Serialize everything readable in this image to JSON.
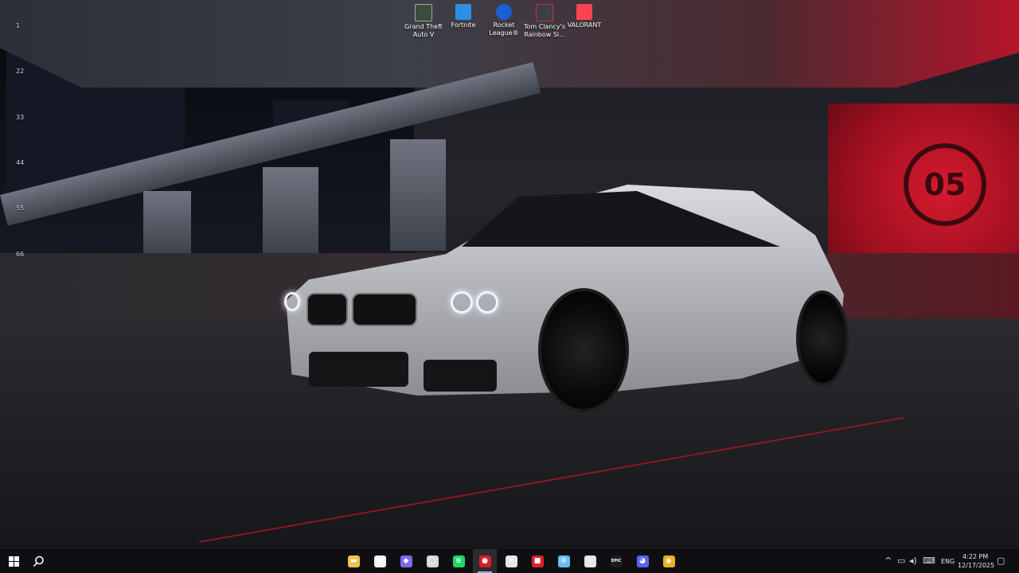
{
  "desktop": {
    "side_numbers": [
      "1",
      "22",
      "33",
      "44",
      "55",
      "66"
    ],
    "icons": [
      {
        "label": "Grand Theft Auto V",
        "icon": "gta-v-icon",
        "color": "#3c4b3a"
      },
      {
        "label": "Fortnite",
        "icon": "fortnite-icon",
        "color": "#2e8fe3"
      },
      {
        "label": "Rocket League®",
        "icon": "rocket-league-icon",
        "color": "#1a5fd6"
      },
      {
        "label": "Tom Clancy's Rainbow Si...",
        "icon": "rainbow-six-icon",
        "color": "#3a3f48"
      },
      {
        "label": "VALORANT",
        "icon": "valorant-icon",
        "color": "#fa4454"
      }
    ],
    "wallpaper_badge": "05"
  },
  "taskbar": {
    "start_icon": "windows-start-icon",
    "search_icon": "search-icon",
    "apps": [
      {
        "name": "file-explorer-icon",
        "glyph": "▬",
        "color": "#f0c34a"
      },
      {
        "name": "microsoft-store-icon",
        "glyph": "▣",
        "color": "#f2f2f2"
      },
      {
        "name": "game-controller-icon",
        "glyph": "◆",
        "color": "#7b6cf2"
      },
      {
        "name": "chat-app-icon",
        "glyph": "◯",
        "color": "#d9d9d9"
      },
      {
        "name": "spotify-icon",
        "glyph": "≋",
        "color": "#1ed760"
      },
      {
        "name": "red-app-icon",
        "glyph": "●",
        "color": "#d61f2b"
      },
      {
        "name": "capcut-icon",
        "glyph": "✕",
        "color": "#e6e6e6"
      },
      {
        "name": "rockstar-launcher-icon",
        "glyph": "■",
        "color": "#e0202e"
      },
      {
        "name": "steam-icon",
        "glyph": "⚙",
        "color": "#66c0f4"
      },
      {
        "name": "epic-circle-icon",
        "glyph": "◎",
        "color": "#e6e6e6"
      },
      {
        "name": "epic-games-icon",
        "glyph": "EPIC",
        "color": "#1c1c1c"
      },
      {
        "name": "discord-icon",
        "glyph": "◕",
        "color": "#5865f2"
      },
      {
        "name": "chrome-icon",
        "glyph": "◉",
        "color": "#e8b21e"
      }
    ],
    "active_app_index": 5,
    "tray": {
      "chevron": "^",
      "language": "ENG",
      "time": "4:22 PM",
      "date": "12/17/2025"
    }
  }
}
